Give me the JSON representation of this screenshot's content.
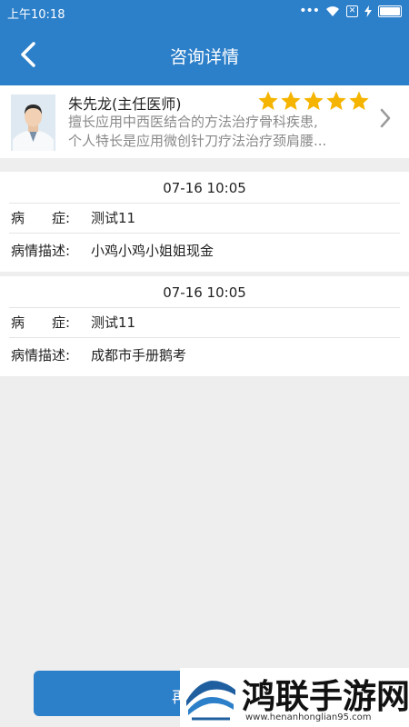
{
  "status_bar": {
    "time": "上午10:18",
    "icons": [
      "more-dots-icon",
      "wifi-icon",
      "sim-x-icon",
      "charging-icon",
      "battery-icon"
    ]
  },
  "header": {
    "title": "咨询详情",
    "back_icon": "chevron-left-icon"
  },
  "doctor": {
    "name": "朱先龙(主任医师)",
    "rating": 5,
    "rating_max": 5,
    "description_line1": "擅长应用中西医结合的方法治疗骨科疾患,",
    "description_line2": "个人特长是应用微创针刀疗法治疗颈肩腰..."
  },
  "consultations": [
    {
      "datetime": "07-16 10:05",
      "symptom_label": "病　　症:",
      "symptom_value": "测试11",
      "description_label": "病情描述:",
      "description_value": "小鸡小鸡小姐姐现金"
    },
    {
      "datetime": "07-16 10:05",
      "symptom_label": "病　　症:",
      "symptom_value": "测试11",
      "description_label": "病情描述:",
      "description_value": "成都市手册鹅考"
    }
  ],
  "bottom_button": {
    "label": "再"
  },
  "watermark": {
    "title": "鸿联手游网",
    "url": "www.henanhonglian95.com"
  },
  "colors": {
    "primary": "#2c7fc9",
    "star": "#f5b400",
    "background": "#eeeeee"
  }
}
